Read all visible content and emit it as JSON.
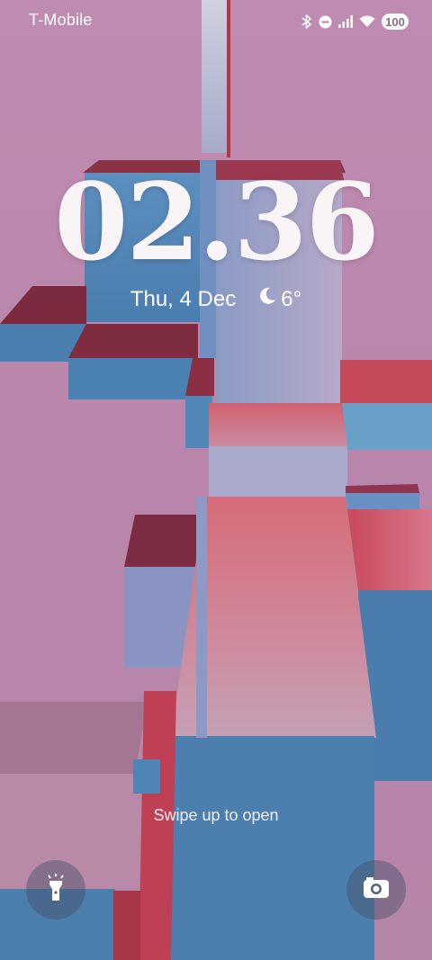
{
  "status_bar": {
    "carrier": "T-Mobile",
    "icons": [
      "bluetooth-icon",
      "do-not-disturb-icon",
      "signal-icon",
      "wifi-icon"
    ],
    "battery_level": "100"
  },
  "lock_screen": {
    "time": "02.36",
    "date": "Thu, 4 Dec",
    "weather": {
      "icon": "moon-icon",
      "temperature": "6°"
    },
    "swipe_hint": "Swipe up to open",
    "shortcuts": [
      {
        "name": "flashlight",
        "icon": "flashlight-icon"
      },
      {
        "name": "camera",
        "icon": "camera-icon"
      }
    ]
  },
  "colors": {
    "background_pink": "#b585a8",
    "cube_blue": "#4a7fae",
    "cube_red": "#d25a6a"
  }
}
